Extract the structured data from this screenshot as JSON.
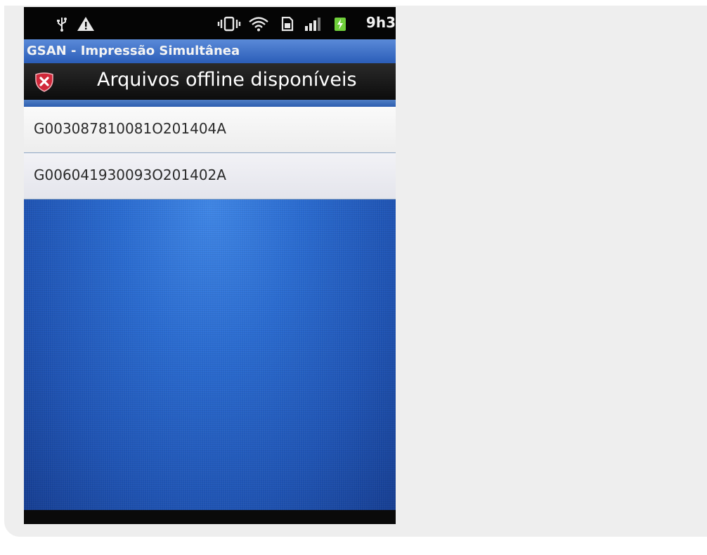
{
  "status_bar": {
    "icons": [
      "usb-icon",
      "warning-icon",
      "vibrate-icon",
      "wifi-icon",
      "sd-card-icon",
      "signal-icon",
      "battery-icon"
    ],
    "time": "9h3"
  },
  "app": {
    "title": "GSAN - Impressão Simultânea"
  },
  "dialog": {
    "title": "Arquivos offline disponíveis",
    "icon": "alert-shield-icon",
    "items": [
      {
        "label": "G003087810081O201404A"
      },
      {
        "label": "G006041930093O201402A"
      }
    ]
  },
  "colors": {
    "title_bar": "#3a6cc8",
    "content_background": "#2a6bd0",
    "icon_red": "#d0283a"
  }
}
